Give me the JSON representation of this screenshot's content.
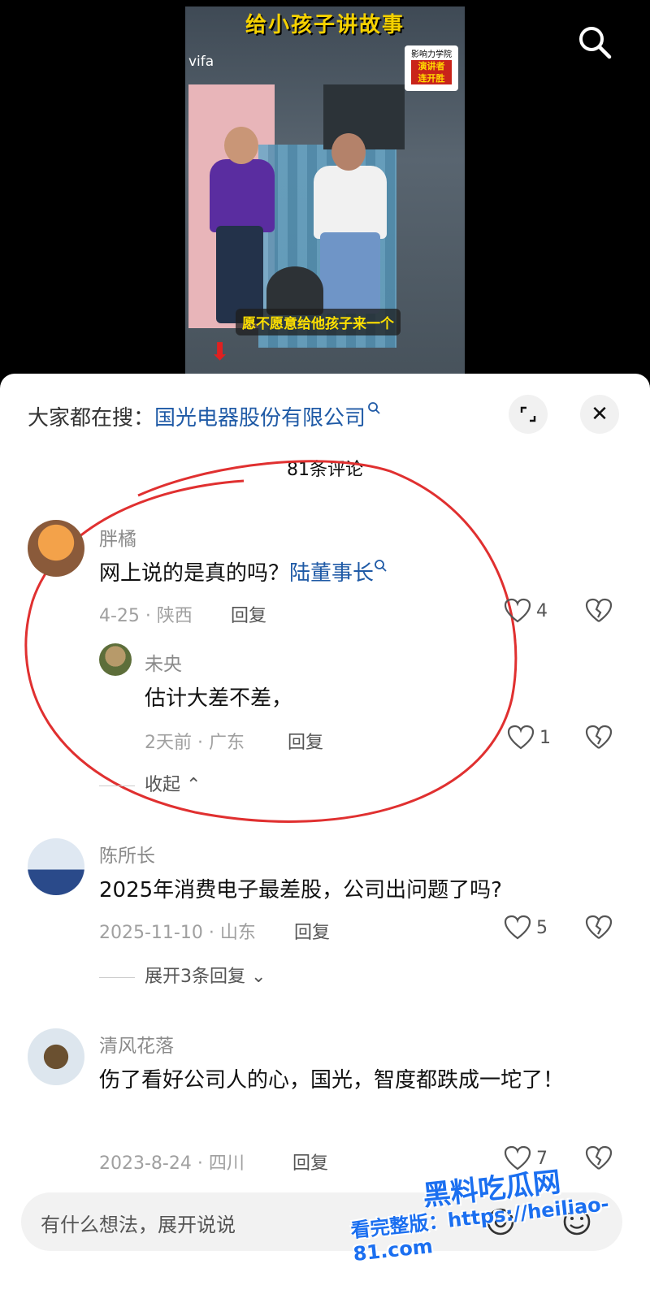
{
  "video": {
    "title": "给小孩子讲故事",
    "brand": "vifa",
    "badge_top": "影响力学院",
    "badge_mid": "演讲者\n连开胜",
    "subtitle": "愿不愿意给他孩子来一个"
  },
  "header": {
    "prefix": "大家都在搜：",
    "keyword": "国光电器股份有限公司",
    "expand_icon": "⌐",
    "close_icon": "✕"
  },
  "comment_count": "81条评论",
  "comments": [
    {
      "user": "胖橘",
      "text": "网上说的是真的吗？",
      "link": "陆董事长",
      "meta": "4-25 · 陕西",
      "reply": "回复",
      "likes": "4",
      "sub": {
        "user": "未央",
        "text": "估计大差不差，",
        "meta": "2天前 · 广东",
        "reply": "回复",
        "likes": "1"
      },
      "collapse": "收起"
    },
    {
      "user": "陈所长",
      "text": "2025年消费电子最差股，公司出问题了吗?",
      "meta": "2025-11-10 · 山东",
      "reply": "回复",
      "likes": "5",
      "expand": "展开3条回复"
    },
    {
      "user": "清风花落",
      "text": "伤了看好公司人的心，国光，智度都跌成一坨了！",
      "meta": "2023-8-24 · 四川",
      "reply": "回复",
      "likes": "7"
    }
  ],
  "input": {
    "placeholder": "有什么想法，展开说说"
  },
  "watermark": {
    "line1": "黑料吃瓜网",
    "line2": "看完整版：https://heiliao-81.com"
  },
  "colors": {
    "link": "#1f5aa6",
    "annotation": "#e03030"
  }
}
